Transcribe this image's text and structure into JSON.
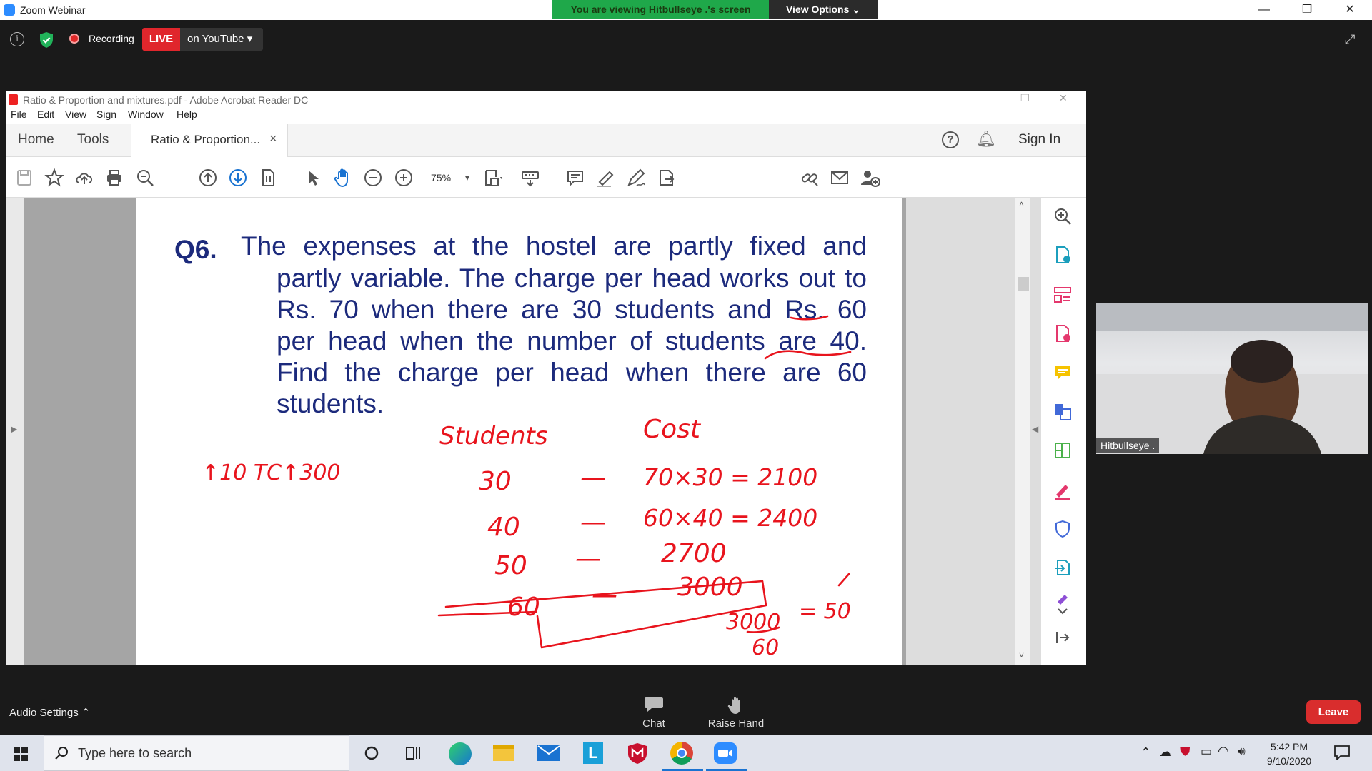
{
  "window": {
    "title": "Zoom Webinar",
    "minimize": "—",
    "restore": "❐",
    "close": "✕"
  },
  "share_banner": {
    "text": "You are viewing Hitbullseye .'s screen",
    "view_options": "View Options ⌄"
  },
  "zoom_bar": {
    "recording_label": "Recording",
    "live_badge": "LIVE",
    "live_platform": "on YouTube ▾"
  },
  "acrobat": {
    "title": "Ratio & Proportion and mixtures.pdf - Adobe Acrobat Reader DC",
    "menu": [
      "File",
      "Edit",
      "View",
      "Sign",
      "Window",
      "Help"
    ],
    "tabs": {
      "home": "Home",
      "tools": "Tools",
      "doc": "Ratio & Proportion...",
      "doc_close": "×"
    },
    "sign_in": "Sign In",
    "zoom_value": "75%",
    "zoom_arrow": "▾"
  },
  "question": {
    "label": "Q6.",
    "lines": [
      "The expenses at the hostel are partly fixed and",
      "partly variable. The charge per head works out to",
      "Rs. 70 when there are 30 students and Rs. 60",
      "per head when the number of students are 40.",
      "Find the charge per head when there are 60",
      "students."
    ]
  },
  "handwriting": {
    "header_left": "↑10  TC↑300",
    "col1_header": "Students",
    "col2_header": "Cost",
    "rows": [
      {
        "students": "30",
        "dash": "—",
        "cost": "70×30 = 2100"
      },
      {
        "students": "40",
        "dash": "—",
        "cost": "60×40 = 2400"
      },
      {
        "students": "50",
        "dash": "—",
        "cost": "2700"
      },
      {
        "students": "60",
        "dash": "—",
        "cost": "3000"
      }
    ],
    "fraction_num": "3000",
    "fraction_den": "60",
    "fraction_eq": "= 50",
    "ink_color": "#e8141d"
  },
  "participant": {
    "name": "Hitbullseye ."
  },
  "bottom_bar": {
    "audio_settings": "Audio Settings ⌃",
    "chat": "Chat",
    "raise_hand": "Raise Hand",
    "leave": "Leave"
  },
  "taskbar": {
    "search_placeholder": "Type here to search",
    "time": "5:42 PM",
    "date": "9/10/2020"
  }
}
